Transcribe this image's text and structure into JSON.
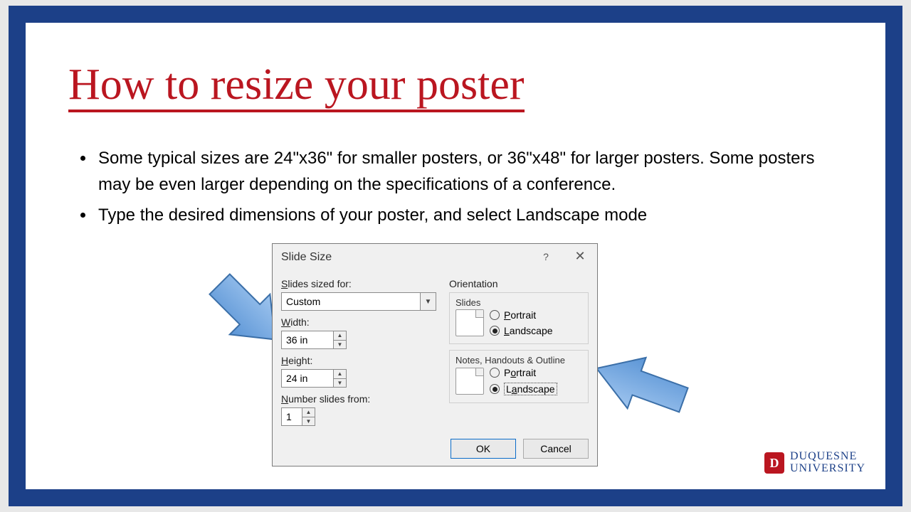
{
  "title": "How to resize your poster",
  "bullets": [
    "Some typical sizes are 24\"x36\" for smaller posters, or 36\"x48\" for larger posters. Some posters may be even larger depending on the specifications of a conference.",
    "Type the desired dimensions of your poster, and select Landscape mode"
  ],
  "dialog": {
    "title": "Slide Size",
    "help": "?",
    "close": "✕",
    "slides_sized_for_label": "Slides sized for:",
    "slides_sized_for_value": "Custom",
    "width_label": "Width:",
    "width_value": "36 in",
    "height_label": "Height:",
    "height_value": "24 in",
    "number_from_label": "Number slides from:",
    "number_from_value": "1",
    "orientation_label": "Orientation",
    "slides_group": "Slides",
    "notes_group": "Notes, Handouts & Outline",
    "portrait": "Portrait",
    "landscape": "Landscape",
    "ok": "OK",
    "cancel": "Cancel"
  },
  "logo": {
    "badge": "D",
    "line1": "DUQUESNE",
    "line2": "UNIVERSITY"
  }
}
